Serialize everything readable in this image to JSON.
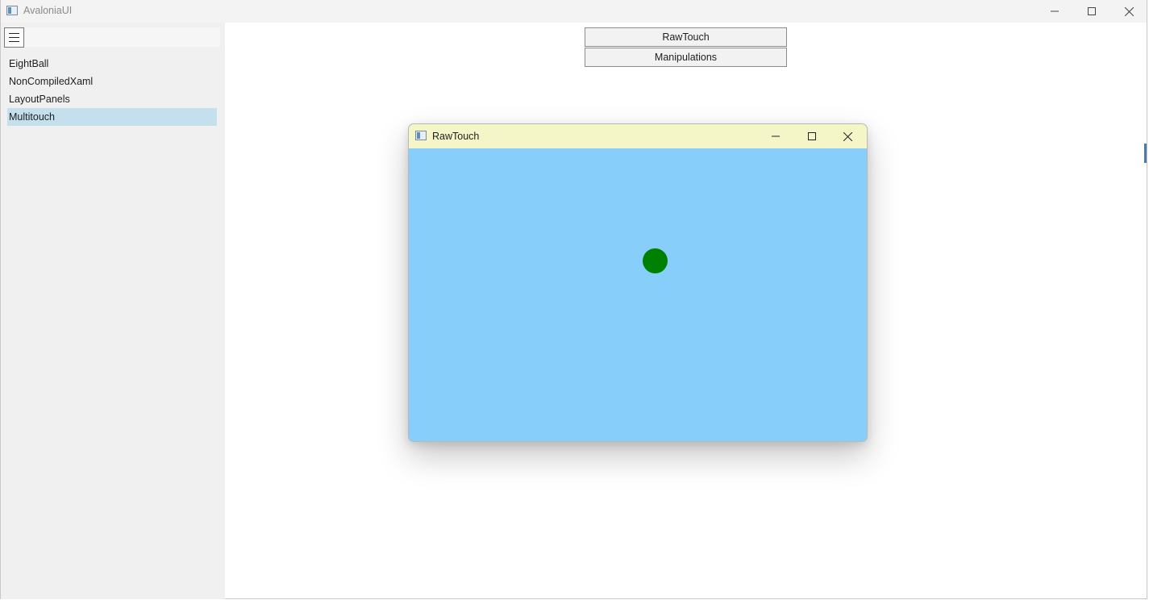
{
  "app": {
    "title": "AvaloniaUI",
    "window_controls": {
      "minimize": "minimize-icon",
      "maximize": "maximize-icon",
      "close": "close-icon"
    }
  },
  "sidebar": {
    "menu_icon": "hamburger-icon",
    "items": [
      {
        "label": "EightBall",
        "selected": false
      },
      {
        "label": "NonCompiledXaml",
        "selected": false
      },
      {
        "label": "LayoutPanels",
        "selected": false
      },
      {
        "label": "Multitouch",
        "selected": true
      }
    ],
    "selected_color": "#c5e0ed"
  },
  "content": {
    "buttons": {
      "rawtouch_label": "RawTouch",
      "manipulations_label": "Manipulations"
    }
  },
  "child_window": {
    "title": "RawTouch",
    "titlebar_color": "#f5f6c8",
    "canvas_color": "#87cefa",
    "touch_point_color": "#008000"
  }
}
